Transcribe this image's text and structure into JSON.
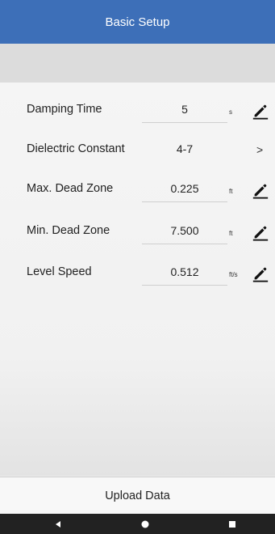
{
  "header": {
    "title": "Basic Setup"
  },
  "colors": {
    "header_bg": "#3d6fb8",
    "nav_bg": "#222222"
  },
  "settings": [
    {
      "label": "Damping Time",
      "value": "5",
      "unit": "s",
      "action": "edit"
    },
    {
      "label": "Dielectric Constant",
      "value": "4-7",
      "unit": "",
      "action": "chevron"
    },
    {
      "label": "Max. Dead Zone",
      "value": "0.225",
      "unit": "ft",
      "action": "edit"
    },
    {
      "label": "Min. Dead Zone",
      "value": "7.500",
      "unit": "ft",
      "action": "edit"
    },
    {
      "label": "Level Speed",
      "value": "0.512",
      "unit": "ft/s",
      "action": "edit"
    }
  ],
  "chevron_glyph": ">",
  "footer": {
    "label": "Upload Data"
  },
  "navbar": {
    "icons": [
      "back-icon",
      "home-icon",
      "recents-icon"
    ]
  }
}
